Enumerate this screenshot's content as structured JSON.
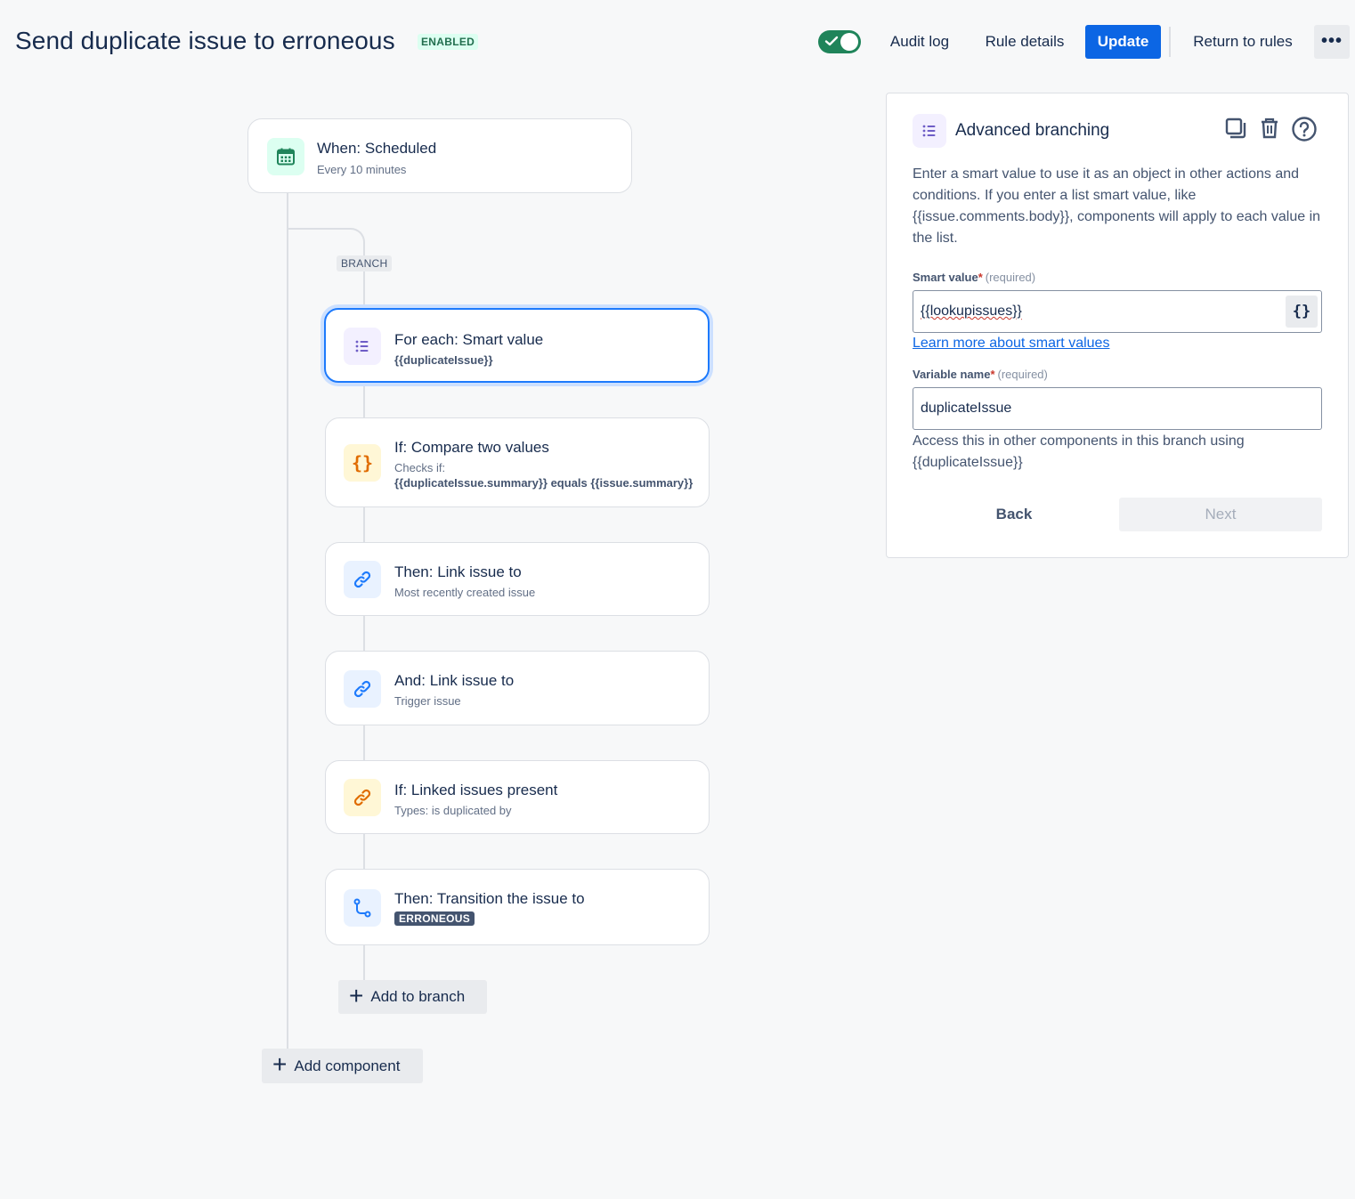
{
  "header": {
    "title": "Send duplicate issue to erroneous",
    "status": "ENABLED",
    "toggle_on": true,
    "audit_log": "Audit log",
    "rule_details": "Rule details",
    "update": "Update",
    "return_to_rules": "Return to rules",
    "more": "•••"
  },
  "flow": {
    "trigger": {
      "title": "When: Scheduled",
      "subtitle": "Every 10 minutes",
      "icon": "calendar-icon"
    },
    "branch_label": "BRANCH",
    "branch_items": [
      {
        "title": "For each: Smart value",
        "subtitle": "{{duplicateIssue}}",
        "icon": "list-icon"
      },
      {
        "title": "If: Compare two values",
        "subtitle_prefix": "Checks if:",
        "subtitle": "{{duplicateIssue.summary}} equals {{issue.summary}}",
        "icon": "braces-icon"
      },
      {
        "title": "Then: Link issue to",
        "subtitle": "Most recently created issue",
        "icon": "link-icon"
      },
      {
        "title": "And: Link issue to",
        "subtitle": "Trigger issue",
        "icon": "link-icon"
      },
      {
        "title": "If: Linked issues present",
        "subtitle": "Types: is duplicated by",
        "icon": "link-icon"
      },
      {
        "title": "Then: Transition the issue to",
        "lozenge": "ERRONEOUS",
        "icon": "transition-icon"
      }
    ],
    "add_to_branch": "Add to branch",
    "add_component": "Add component"
  },
  "panel": {
    "title": "Advanced branching",
    "description": "Enter a smart value to use it as an object in other actions and conditions. If you enter a list smart value, like {{issue.comments.body}}, components will apply to each value in the list.",
    "smart_value_label": "Smart value",
    "required_mark": "*",
    "required_text": "(required)",
    "smart_value": "{{lookupissues}}",
    "smart_value_btn": "{}",
    "learn_more": "Learn more about smart values",
    "variable_name_label": "Variable name",
    "variable_name": "duplicateIssue",
    "helper_text": "Access this in other components in this branch using {{duplicateIssue}}",
    "back": "Back",
    "next": "Next"
  }
}
